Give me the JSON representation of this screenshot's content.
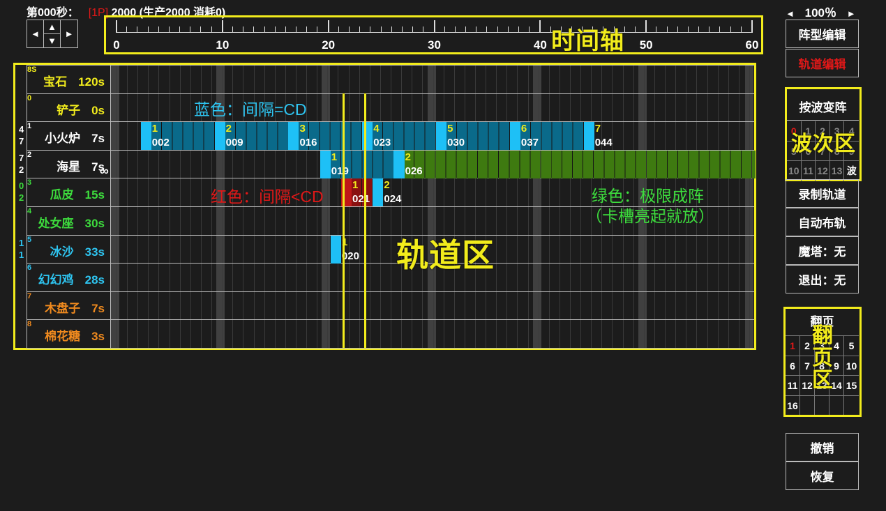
{
  "status": {
    "time_label": "第000秒：",
    "player": "[1P]",
    "resources": "2000 (生产2000 消耗0)"
  },
  "zoom": {
    "left_arrow": "◄",
    "value": "100％",
    "right_arrow": "►"
  },
  "nav": {
    "left": "◄",
    "up": "▲",
    "down": "▼",
    "right": "►"
  },
  "timeline": {
    "ticks": [
      "0",
      "10",
      "20",
      "30",
      "40",
      "50",
      "60"
    ],
    "overlay_label": "时间轴"
  },
  "rows": [
    {
      "index": "8S",
      "name": "宝石",
      "cd": "120s",
      "color": "#f2ec1c"
    },
    {
      "index": "0",
      "name": "铲子",
      "cd": "0s",
      "color": "#f2ec1c"
    },
    {
      "index": "1",
      "name": "小火炉",
      "cd": "7s",
      "color": "#ffffff"
    },
    {
      "index": "2",
      "name": "海星",
      "cd": "7s",
      "color": "#ffffff",
      "extra": "∞"
    },
    {
      "index": "3",
      "name": "瓜皮",
      "cd": "15s",
      "color": "#3ddc3d"
    },
    {
      "index": "4",
      "name": "处女座",
      "cd": "30s",
      "color": "#3ddc3d"
    },
    {
      "index": "5",
      "name": "冰沙",
      "cd": "33s",
      "color": "#2ec4f0"
    },
    {
      "index": "6",
      "name": "幻幻鸡",
      "cd": "28s",
      "color": "#2ec4f0"
    },
    {
      "index": "7",
      "name": "木盘子",
      "cd": "7s",
      "color": "#f08a1e"
    },
    {
      "index": "8",
      "name": "棉花糖",
      "cd": "3s",
      "color": "#f08a1e"
    }
  ],
  "side_numbers": [
    {
      "a": "4",
      "b": "7",
      "color": "#ffffff"
    },
    {
      "a": "7",
      "b": "2",
      "color": "#ffffff"
    },
    {
      "a": "0",
      "b": "2",
      "color": "#3ddc3d"
    },
    {
      "a": "1",
      "b": "1",
      "color": "#2ec4f0"
    }
  ],
  "blocks": [
    {
      "row": 2,
      "start": 1.7,
      "end": 8.7,
      "num": "1",
      "code": "002",
      "type": "blue"
    },
    {
      "row": 2,
      "start": 8.7,
      "end": 15.7,
      "num": "2",
      "code": "009",
      "type": "blue"
    },
    {
      "row": 2,
      "start": 15.7,
      "end": 22.7,
      "num": "3",
      "code": "016",
      "type": "blue"
    },
    {
      "row": 2,
      "start": 22.7,
      "end": 29.7,
      "num": "4",
      "code": "023",
      "type": "blue"
    },
    {
      "row": 2,
      "start": 29.7,
      "end": 36.7,
      "num": "5",
      "code": "030",
      "type": "blue"
    },
    {
      "row": 2,
      "start": 36.7,
      "end": 43.7,
      "num": "6",
      "code": "037",
      "type": "blue"
    },
    {
      "row": 2,
      "start": 43.7,
      "end": 44.7,
      "num": "7",
      "code": "044",
      "type": "blue"
    },
    {
      "row": 3,
      "start": 18.7,
      "end": 25.7,
      "num": "1",
      "code": "019",
      "type": "blue"
    },
    {
      "row": 3,
      "start": 25.7,
      "end": 60.0,
      "num": "2",
      "code": "026",
      "type": "green"
    },
    {
      "row": 4,
      "start": 20.7,
      "end": 23.7,
      "num": "1",
      "code": "021",
      "type": "red"
    },
    {
      "row": 4,
      "start": 23.7,
      "end": 24.7,
      "num": "2",
      "code": "024",
      "type": "blue"
    },
    {
      "row": 6,
      "start": 19.7,
      "end": 20.7,
      "num": "1",
      "code": "020",
      "type": "blue"
    }
  ],
  "annotations": {
    "blue": "蓝色：间隔=CD",
    "red": "红色：间隔<CD",
    "green1": "绿色：极限成阵",
    "green2": "（卡槽亮起就放）",
    "track_label": "轨道区"
  },
  "right_buttons": [
    "阵型编辑",
    "轨道编辑",
    "按波变阵",
    "录制轨道",
    "自动布轨",
    "魔塔：无",
    "退出：无",
    "撤销",
    "恢复"
  ],
  "wave_area": {
    "label": "波次区",
    "cells": [
      "0",
      "1",
      "2",
      "3",
      "4",
      "5",
      "6",
      "7",
      "8",
      "9",
      "10",
      "11",
      "12",
      "13",
      "波"
    ]
  },
  "page_area": {
    "title": "翻页",
    "label": "翻页区",
    "cells": [
      "1",
      "2",
      "3",
      "4",
      "5",
      "6",
      "7",
      "8",
      "9",
      "10",
      "11",
      "12",
      "13",
      "14",
      "15",
      "16"
    ]
  },
  "colors": {
    "accent_yellow": "#f2ec1c",
    "blue_block": "#0a6a8a",
    "blue_edge": "#1ec0f6",
    "green_block": "#3e7a10",
    "red_block": "#8a1010",
    "active_red": "#e01818"
  }
}
